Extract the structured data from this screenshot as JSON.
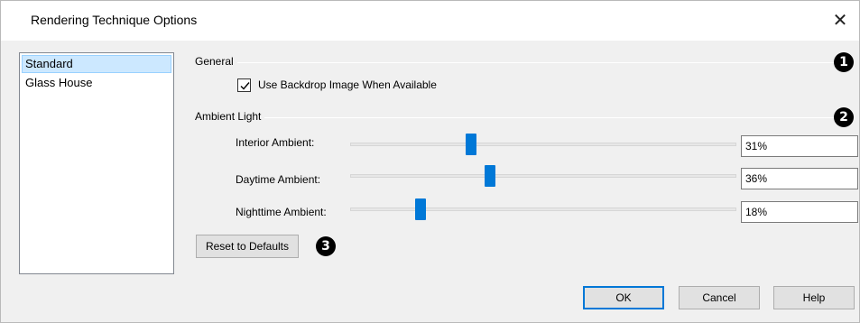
{
  "window": {
    "title": "Rendering Technique Options",
    "close_glyph": "✕"
  },
  "techniques": [
    {
      "label": "Standard",
      "selected": true
    },
    {
      "label": "Glass House",
      "selected": false
    }
  ],
  "general": {
    "label": "General",
    "callout": "1",
    "backdrop_checkbox": {
      "label": "Use Backdrop Image When Available",
      "checked": true
    }
  },
  "ambient": {
    "label": "Ambient Light",
    "callout": "2",
    "sliders": [
      {
        "label": "Interior Ambient:",
        "value": "31%",
        "fraction": 0.31
      },
      {
        "label": "Daytime Ambient:",
        "value": "36%",
        "fraction": 0.36
      },
      {
        "label": "Nighttime Ambient:",
        "value": "18%",
        "fraction": 0.18
      }
    ]
  },
  "reset": {
    "label": "Reset to Defaults",
    "callout": "3"
  },
  "buttons": {
    "ok": "OK",
    "cancel": "Cancel",
    "help": "Help"
  },
  "colors": {
    "accent": "#0078d7",
    "selection": "#cce8ff"
  }
}
